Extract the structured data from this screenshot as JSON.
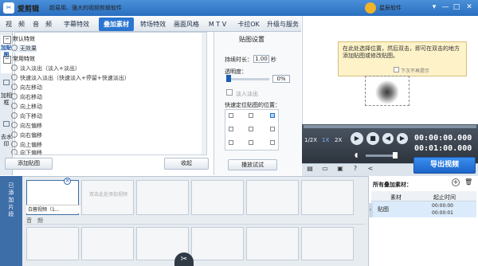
{
  "window": {
    "app_name": "爱剪辑",
    "slogan": "超易用、强大的视频剪辑软件",
    "vip_label": "星辰软件",
    "controls": [
      "▾",
      "—",
      "□",
      "✕"
    ]
  },
  "menu": [
    "视　频",
    "音　频",
    "字幕特效",
    "叠加素材",
    "转场特效",
    "画面风格",
    "M T V",
    "卡拉OK",
    "升级与服务"
  ],
  "menu_active": "叠加素材",
  "side_tabs": [
    {
      "label": "加贴图",
      "active": true
    },
    {
      "label": "加相框",
      "active": false
    },
    {
      "label": "去水印",
      "active": false
    }
  ],
  "effects": {
    "groups": [
      {
        "name": "默认特效",
        "items": [
          "无效果"
        ]
      },
      {
        "name": "常用特效",
        "items": [
          "淡入淡出（淡入+淡出）",
          "快速淡入淡出（快速淡入+停留+快速淡出）",
          "向左移动",
          "向右移动",
          "向上移动",
          "向下移动",
          "向左偏移",
          "向右偏移",
          "向上偏移",
          "向下偏移"
        ]
      }
    ],
    "selected": "无效果"
  },
  "buttons": {
    "add_sticker": "添加贴图",
    "collect": "收起",
    "preview_effect": "播放试试",
    "export": "导出视频"
  },
  "sticker_settings": {
    "title": "贴图设置",
    "duration_label": "持续时长：",
    "duration_value": "1.00",
    "duration_unit": "秒",
    "opacity_label": "透明度：",
    "opacity_value": "0%",
    "opacity_fraction": 0,
    "fade_label": "淡入淡出",
    "position_label": "快速定位贴图的位置：",
    "position_selected": "top-right"
  },
  "preview": {
    "tooltip": "在此处选择位置，然后双击，即可在双击的地方添加贴图或修改贴图。",
    "dont_show": "下次不再提示"
  },
  "playback": {
    "speeds": [
      "1/2X",
      "1X",
      "2X"
    ],
    "active_speed": "1X",
    "current_time": "00:00:00.000",
    "total_time": "00:01:00.000",
    "volume_fraction": 0.85
  },
  "timeline": {
    "side_label": "已添加片段",
    "first_clip_label": "白蓉视频（1...",
    "drop_hint": "双击此处添加视频",
    "audio_label": "音　频"
  },
  "overlay_panel": {
    "title": "所有叠加素材：",
    "col_material": "素材",
    "col_time": "起止时间",
    "row_name": "贴图",
    "row_start": "00:00:00",
    "row_end": "00:00:01"
  },
  "icons": {
    "logo": "scissors-logo",
    "vip": "vip-crown-icon",
    "scissors": "scissors-icon"
  }
}
